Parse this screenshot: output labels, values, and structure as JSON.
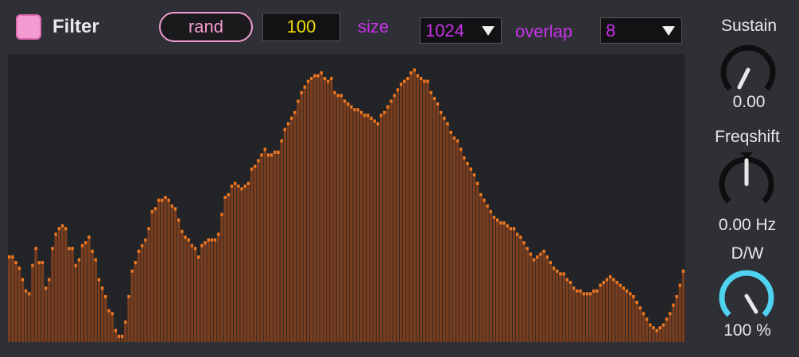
{
  "header": {
    "filter_toggle_on": true,
    "title": "Filter",
    "rand_label": "rand",
    "rand_value": "100",
    "size_label": "size",
    "size_value": "1024",
    "overlap_label": "overlap",
    "overlap_value": "8"
  },
  "knobs": {
    "sustain": {
      "label": "Sustain",
      "value": "0.00"
    },
    "freqshift": {
      "label": "Freqshift",
      "value": "0.00 Hz"
    },
    "dry_wet": {
      "label": "D/W",
      "value": "100 %",
      "level": 1.0
    }
  },
  "colors": {
    "background": "#2e3036",
    "spectrum_bg": "#232427",
    "bar_fill": "#7a3e1e",
    "bar_peak": "#f07820",
    "accent_pink": "#f39bd0",
    "accent_purple": "#c832e8",
    "accent_yellow": "#f0e000",
    "accent_cyan": "#4fd3f0"
  },
  "spectrum": {
    "bar_count": 200,
    "levels": [
      0.3,
      0.3,
      0.28,
      0.26,
      0.22,
      0.18,
      0.17,
      0.27,
      0.33,
      0.28,
      0.28,
      0.19,
      0.22,
      0.33,
      0.38,
      0.4,
      0.41,
      0.4,
      0.33,
      0.33,
      0.27,
      0.29,
      0.34,
      0.35,
      0.37,
      0.32,
      0.29,
      0.22,
      0.19,
      0.16,
      0.11,
      0.1,
      0.04,
      0.02,
      0.02,
      0.07,
      0.16,
      0.25,
      0.28,
      0.32,
      0.34,
      0.36,
      0.4,
      0.46,
      0.47,
      0.5,
      0.5,
      0.51,
      0.5,
      0.48,
      0.47,
      0.43,
      0.39,
      0.37,
      0.36,
      0.34,
      0.33,
      0.3,
      0.34,
      0.35,
      0.36,
      0.36,
      0.36,
      0.38,
      0.45,
      0.51,
      0.52,
      0.55,
      0.56,
      0.55,
      0.54,
      0.55,
      0.56,
      0.61,
      0.62,
      0.64,
      0.66,
      0.68,
      0.66,
      0.66,
      0.67,
      0.67,
      0.71,
      0.75,
      0.77,
      0.79,
      0.81,
      0.85,
      0.88,
      0.9,
      0.92,
      0.93,
      0.94,
      0.94,
      0.95,
      0.93,
      0.92,
      0.93,
      0.88,
      0.87,
      0.87,
      0.85,
      0.84,
      0.83,
      0.82,
      0.82,
      0.81,
      0.8,
      0.8,
      0.79,
      0.78,
      0.77,
      0.8,
      0.81,
      0.83,
      0.85,
      0.87,
      0.89,
      0.91,
      0.92,
      0.93,
      0.95,
      0.96,
      0.94,
      0.93,
      0.92,
      0.92,
      0.88,
      0.86,
      0.84,
      0.81,
      0.79,
      0.77,
      0.74,
      0.72,
      0.71,
      0.68,
      0.65,
      0.63,
      0.61,
      0.59,
      0.56,
      0.52,
      0.5,
      0.48,
      0.46,
      0.44,
      0.43,
      0.42,
      0.42,
      0.41,
      0.4,
      0.4,
      0.38,
      0.37,
      0.35,
      0.33,
      0.31,
      0.29,
      0.3,
      0.31,
      0.32,
      0.3,
      0.28,
      0.26,
      0.25,
      0.24,
      0.24,
      0.22,
      0.21,
      0.19,
      0.18,
      0.18,
      0.17,
      0.17,
      0.17,
      0.18,
      0.18,
      0.2,
      0.21,
      0.22,
      0.23,
      0.22,
      0.21,
      0.2,
      0.19,
      0.18,
      0.17,
      0.16,
      0.14,
      0.12,
      0.1,
      0.08,
      0.06,
      0.05,
      0.04,
      0.05,
      0.06,
      0.08,
      0.1,
      0.13,
      0.16,
      0.2,
      0.25
    ]
  }
}
